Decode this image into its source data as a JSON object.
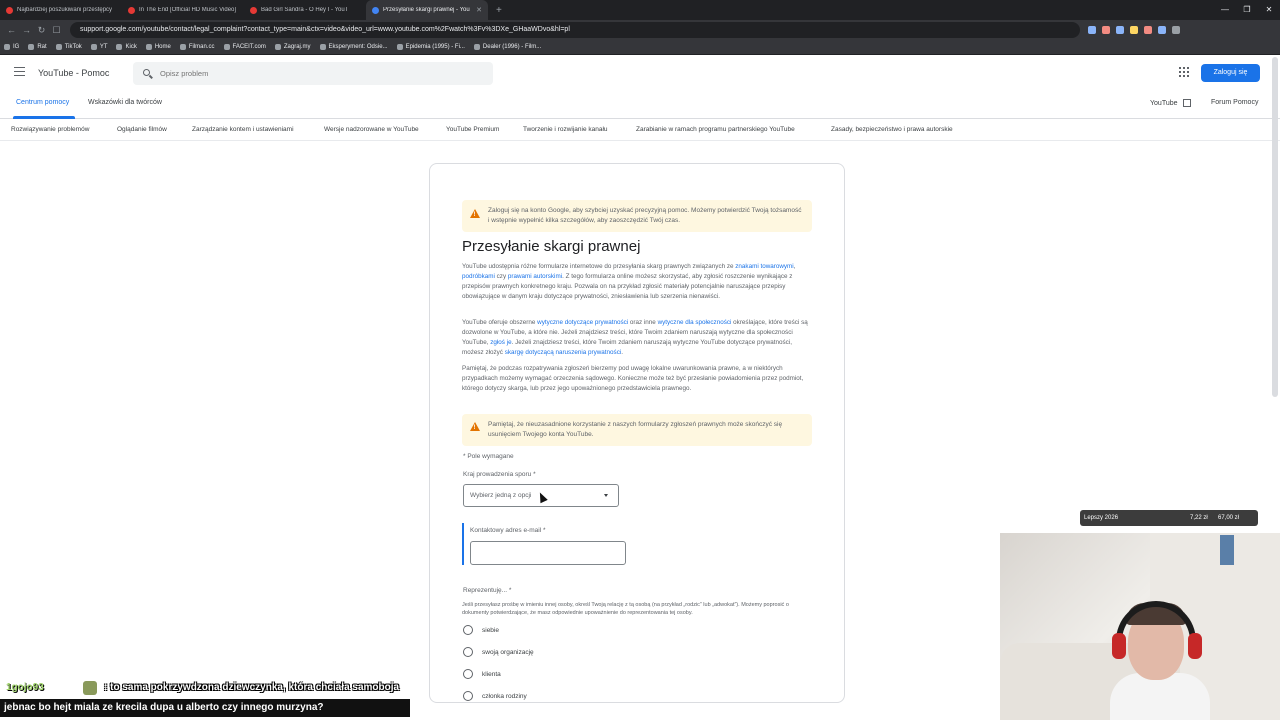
{
  "browser": {
    "tabs": [
      {
        "label": "Najbardziej poszukiwani przestępcy",
        "color": "#e53935"
      },
      {
        "label": "In The End [Official HD Music Video]",
        "color": "#e53935"
      },
      {
        "label": "Bad Girl Sandra - O Hey I - YouT",
        "color": "#e53935"
      },
      {
        "label": "Przesyłanie skargi prawnej - You",
        "color": "#4285f4"
      }
    ],
    "new_tab": "+",
    "url": "support.google.com/youtube/contact/legal_complaint?contact_type=main&ctx=video&video_url=www.youtube.com%2Fwatch%3Fv%3DXe_GHaaWDvo&hl=pl",
    "bookmarks": [
      "IG",
      "Rat",
      "TikTok",
      "YT",
      "Kick",
      "Home",
      "Filman.cc",
      "FACEIT.com",
      "Zagraj.my",
      "Eksperyment: Odsie...",
      "Epidemia (1995) - Fi...",
      "Dealer (1996) - Film..."
    ]
  },
  "header": {
    "title": "YouTube - Pomoc",
    "search_placeholder": "Opisz problem",
    "login_label": "Zaloguj się"
  },
  "subnav": {
    "help_center": "Centrum pomocy",
    "creator_tips": "Wskazówki dla twórców",
    "youtube_link": "YouTube",
    "forum_link": "Forum Pomocy"
  },
  "categories": [
    "Rozwiązywanie problemów",
    "Oglądanie filmów",
    "Zarządzanie kontem i ustawieniami",
    "Wersje nadzorowane w YouTube",
    "YouTube Premium",
    "Tworzenie i rozwijanie kanału",
    "Zarabianie w ramach programu partnerskiego YouTube",
    "Zasady, bezpieczeństwo i prawa autorskie"
  ],
  "form": {
    "signin_alert": "Zaloguj się na konto Google, aby szybciej uzyskać precyzyjną pomoc. Możemy potwierdzić Twoją tożsamość i wstępnie wypełnić kilka szczegółów, aby zaoszczędzić Twój czas.",
    "heading": "Przesyłanie skargi prawnej",
    "para1_a": "YouTube udostępnia różne formularze internetowe do przesyłania skarg prawnych związanych ze ",
    "para1_link1": "znakami towarowymi",
    "para1_b": ", ",
    "para1_link2": "podróbkami",
    "para1_c": " czy ",
    "para1_link3": "prawami autorskimi",
    "para1_d": ". Z tego formularza online możesz skorzystać, aby zgłosić roszczenie wynikające z przepisów prawnych konkretnego kraju. Pozwala on na przykład zgłosić materiały potencjalnie naruszające przepisy obowiązujące w danym kraju dotyczące prywatności, zniesławienia lub szerzenia nienawiści.",
    "para2_a": "YouTube oferuje obszerne ",
    "para2_link1": "wytyczne dotyczące prywatności",
    "para2_b": " oraz inne ",
    "para2_link2": "wytyczne dla społeczności",
    "para2_c": " określające, które treści są dozwolone w YouTube, a które nie. Jeżeli znajdziesz treści, które Twoim zdaniem naruszają wytyczne dla społeczności YouTube, ",
    "para2_link3": "zgłoś je",
    "para2_d": ". Jeżeli znajdziesz treści, które Twoim zdaniem naruszają wytyczne YouTube dotyczące prywatności, możesz złożyć ",
    "para2_link4": "skargę dotyczącą naruszenia prywatności",
    "para2_e": ".",
    "para3": "Pamiętaj, że podczas rozpatrywania zgłoszeń bierzemy pod uwagę lokalne uwarunkowania prawne, a w niektórych przypadkach możemy wymagać orzeczenia sądowego. Konieczne może też być przesłanie powiadomienia przez podmiot, którego dotyczy skarga, lub przez jego upoważnionego przedstawiciela prawnego.",
    "warning_alert": "Pamiętaj, że nieuzasadnione korzystanie z naszych formularzy zgłoszeń prawnych może skończyć się usunięciem Twojego konta YouTube.",
    "required_note": "* Pole wymagane",
    "country_label": "Kraj prowadzenia sporu *",
    "country_placeholder": "Wybierz jedną z opcji",
    "email_label": "Kontaktowy adres e-mail *",
    "email_value": "",
    "represent_label": "Reprezentuję... *",
    "represent_hint": "Jeśli przesyłasz prośbę w imieniu innej osoby, określ Twoją relację z tą osobą (na przykład „rodzic” lub „adwokat”). Możemy poprosić o dokumenty potwierdzające, że masz odpowiednie upoważnienie do reprezentowania tej osoby.",
    "options": [
      "siebie",
      "swoją organizację",
      "klienta",
      "członka rodziny"
    ]
  },
  "overlay": {
    "label": "Lepszy 2026",
    "value1": "7,22 zł",
    "value2": "67,00 zł"
  },
  "chat": {
    "username": "1gojo93",
    "line1": ": to      sama pokrzywdzona dziewczynka, która chciała samoboja",
    "line2": "jebnac bo hejt miala ze krecila dupa u alberto czy innego murzyna?"
  }
}
